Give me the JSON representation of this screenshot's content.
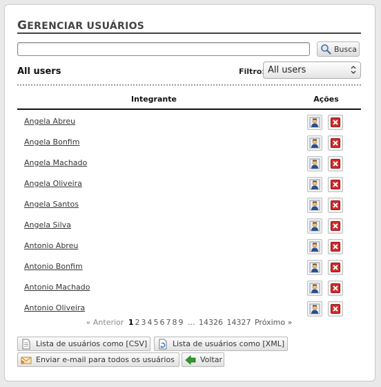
{
  "header": {
    "title_cap": "G",
    "title_rest": "ERENCIAR USUÁRIOS"
  },
  "search": {
    "value": "",
    "placeholder": "",
    "button_label": "Busca"
  },
  "list": {
    "title": "All users"
  },
  "filter": {
    "label": "Filtro:",
    "selected": "All users"
  },
  "table": {
    "columns": {
      "member": "Integrante",
      "actions": "Ações"
    },
    "rows": [
      {
        "name": "Angela Abreu"
      },
      {
        "name": "Angela Bonfim"
      },
      {
        "name": "Angela Machado"
      },
      {
        "name": "Angela Oliveira"
      },
      {
        "name": "Angela Santos"
      },
      {
        "name": "Angela Silva"
      },
      {
        "name": "Antonio Abreu"
      },
      {
        "name": "Antonio Bonfim"
      },
      {
        "name": "Antonio Machado"
      },
      {
        "name": "Antonio Oliveira"
      }
    ]
  },
  "pagination": {
    "prev": "« Anterior",
    "pages": [
      "1",
      "2",
      "3",
      "4",
      "5",
      "6",
      "7",
      "8",
      "9"
    ],
    "current": "1",
    "ellipsis": "...",
    "tail": [
      "14326",
      "14327"
    ],
    "next": "Próximo »"
  },
  "actions": {
    "csv": "Lista de usuários como [CSV]",
    "xml": "Lista de usuários como [XML]",
    "email": "Enviar e-mail para todos os usuários",
    "back": "Voltar"
  },
  "icons": {
    "edit": "user-edit-icon",
    "delete": "delete-icon",
    "search": "magnifier-icon",
    "csv": "document-icon",
    "xml": "xml-document-icon",
    "email": "envelope-icon",
    "back": "back-arrow-icon"
  },
  "colors": {
    "delete_red": "#d42a2a",
    "back_green": "#2f9a2a",
    "rule": "#444444"
  }
}
